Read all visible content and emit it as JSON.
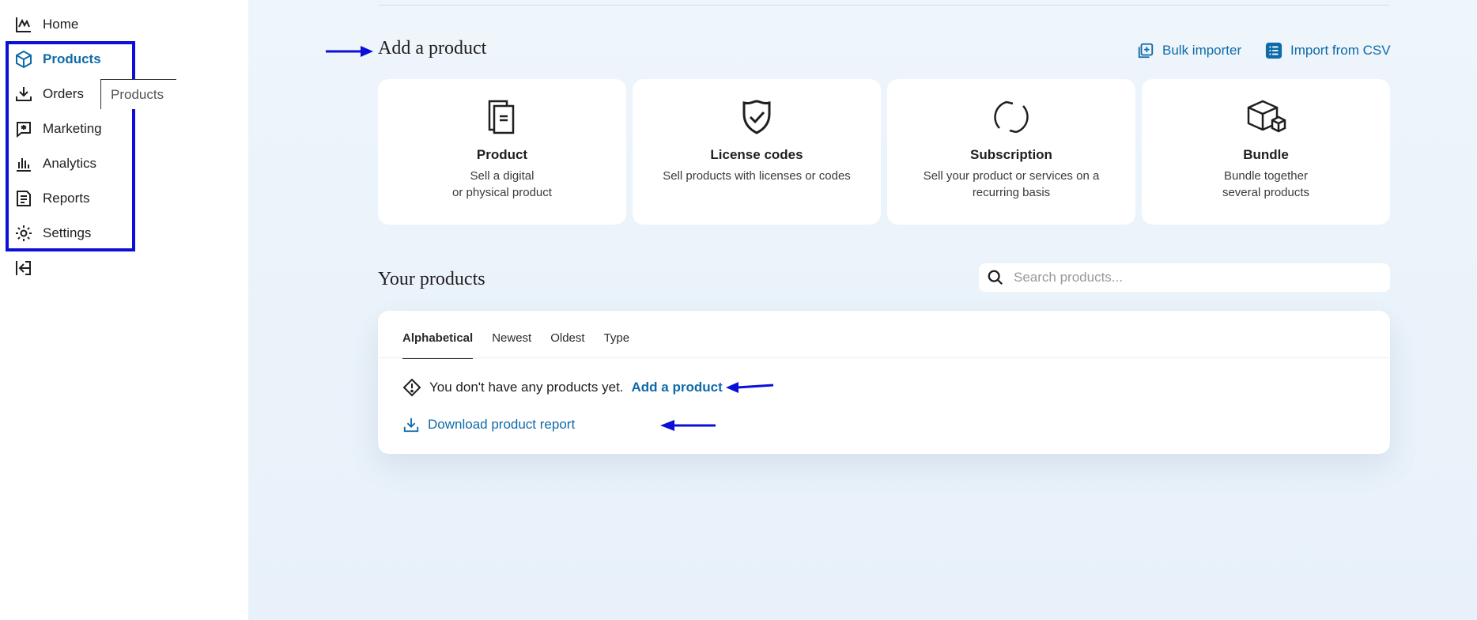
{
  "sidebar": {
    "items": [
      {
        "label": "Home",
        "icon": "home-chart-icon"
      },
      {
        "label": "Products",
        "icon": "cube-icon",
        "active": true
      },
      {
        "label": "Orders",
        "icon": "download-tray-icon"
      },
      {
        "label": "Marketing",
        "icon": "message-star-icon"
      },
      {
        "label": "Analytics",
        "icon": "bar-chart-icon"
      },
      {
        "label": "Reports",
        "icon": "document-icon"
      },
      {
        "label": "Settings",
        "icon": "gear-icon"
      }
    ],
    "logout_icon": "logout-icon",
    "tooltip": "Products"
  },
  "add_product": {
    "title": "Add a product",
    "bulk_importer": "Bulk importer",
    "import_csv": "Import from CSV",
    "cards": [
      {
        "title": "Product",
        "desc": "Sell a digital\nor physical product",
        "icon": "documents-icon"
      },
      {
        "title": "License codes",
        "desc": "Sell products with licenses or codes",
        "icon": "shield-check-icon"
      },
      {
        "title": "Subscription",
        "desc": "Sell your product or services on a\nrecurring basis",
        "icon": "refresh-cycle-icon"
      },
      {
        "title": "Bundle",
        "desc": "Bundle together\nseveral products",
        "icon": "boxes-icon"
      }
    ]
  },
  "your_products": {
    "title": "Your products",
    "search_placeholder": "Search products...",
    "tabs": [
      "Alphabetical",
      "Newest",
      "Oldest",
      "Type"
    ],
    "active_tab": "Alphabetical",
    "empty_text": "You don't have any products yet.",
    "empty_link": "Add a product",
    "download_report": "Download product report"
  },
  "colors": {
    "accent": "#0e6aa8",
    "annotation": "#0a10d8",
    "main_bg": "#eaf2fa"
  }
}
